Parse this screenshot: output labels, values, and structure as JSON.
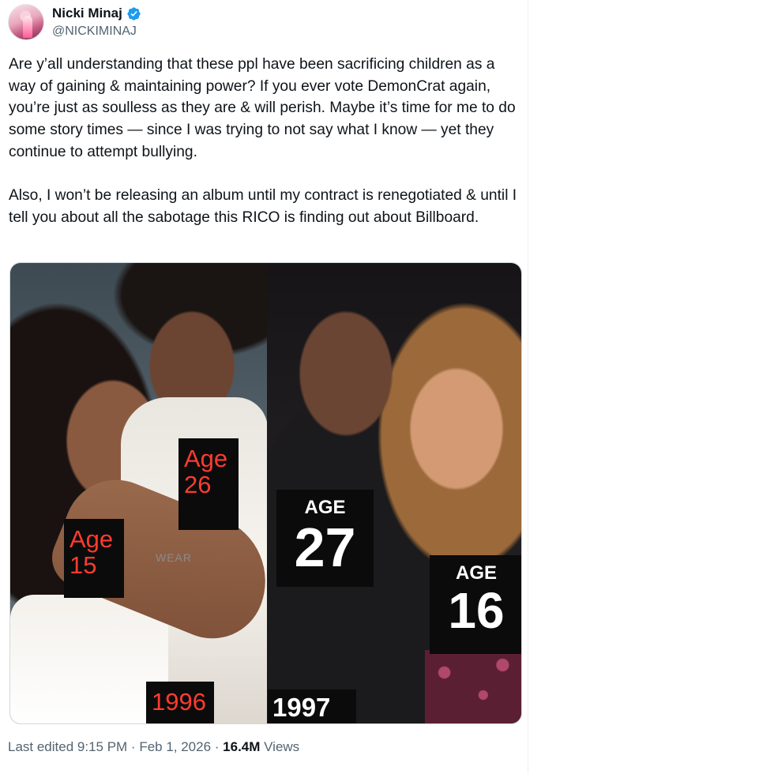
{
  "author": {
    "display_name": "Nicki Minaj",
    "handle": "@NICKIMINAJ",
    "verified": true,
    "verified_color": "#1d9bf0"
  },
  "tweet": {
    "paragraphs": [
      "Are y’all understanding that these ppl have been sacrificing children as a way of gaining & maintaining power? If you ever vote DemonCrat again, you’re just as soulless as they are & will perish. Maybe it’s time for me to do some story times — since I was trying to not say what I know — yet they continue to attempt bullying.",
      "Also, I won’t be releasing an album until my contract is renegotiated & until I tell you about all the sabotage this RICO is finding out about Billboard."
    ]
  },
  "media": {
    "left_photo": {
      "labels": {
        "age_26": "Age\n26",
        "age_15": "Age\n15",
        "year": "1996"
      },
      "shirt_text": "WEAR"
    },
    "right_photo": {
      "labels": {
        "age_27_word": "AGE",
        "age_27_number": "27",
        "age_16_word": "AGE",
        "age_16_number": "16",
        "year": "1997"
      }
    }
  },
  "meta": {
    "edited_prefix": "Last edited 9:15 PM · Feb 1, 2026 · ",
    "views_count": "16.4M",
    "views_label": " Views"
  }
}
